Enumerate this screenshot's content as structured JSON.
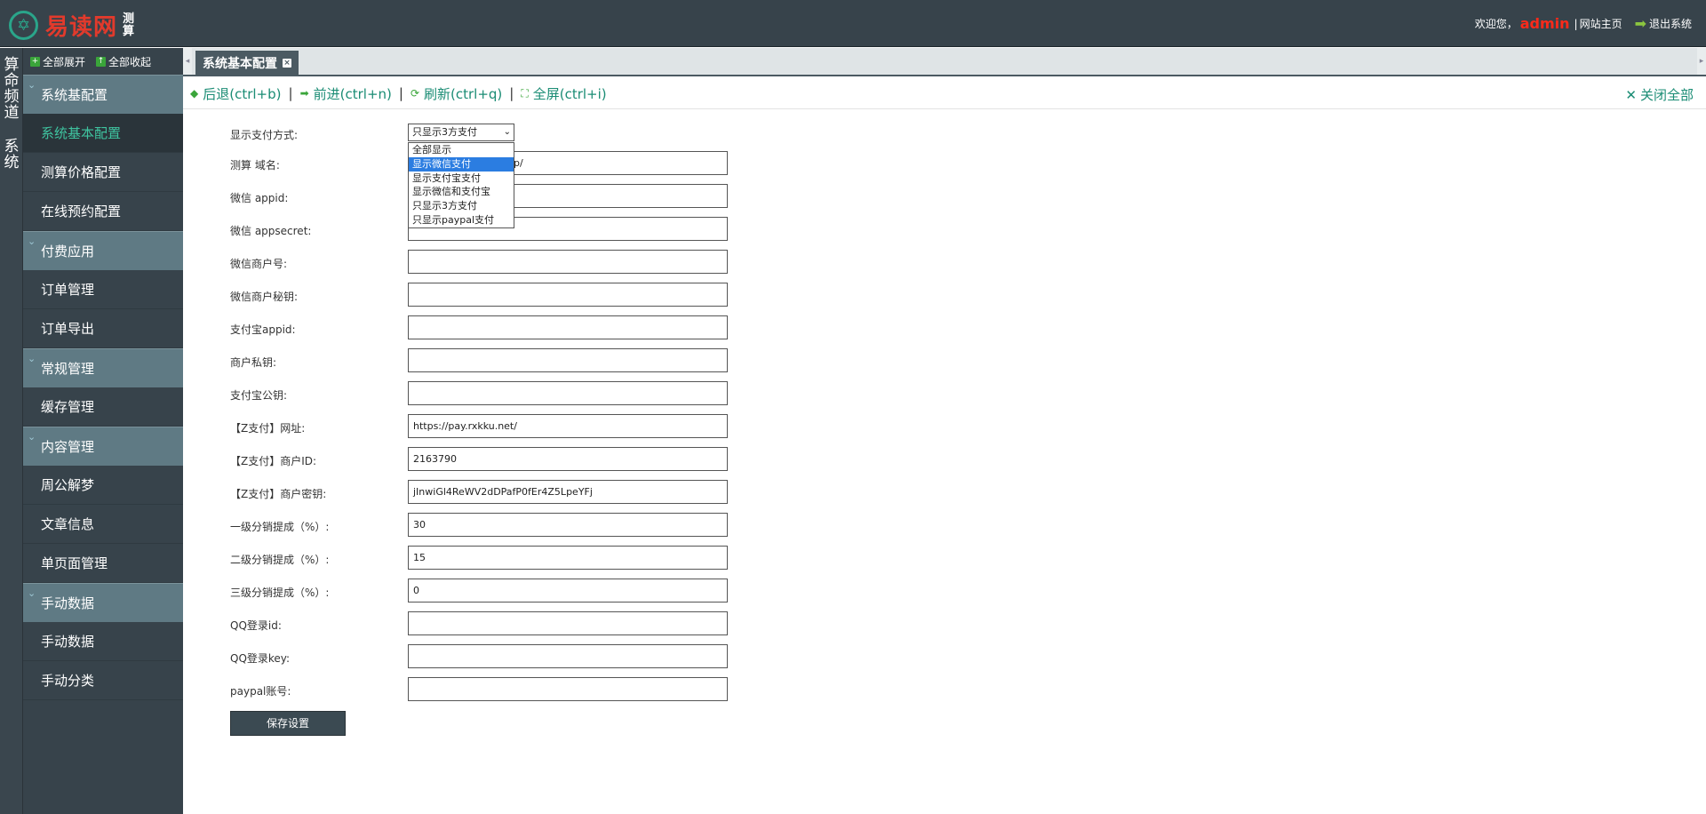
{
  "header": {
    "logo_mark": "✡",
    "logo_text": "易读网",
    "logo_sub": "测算",
    "welcome": "欢迎您，",
    "admin": "admin",
    "sep": "|",
    "home_link": "网站主页",
    "exit_link": "退出系统"
  },
  "vertical_nav": {
    "text1": "算命频道",
    "text2": "系统"
  },
  "sidebar": {
    "expand_all": "全部展开",
    "collapse_all": "全部收起",
    "groups": [
      {
        "label": "系统基配置",
        "items": [
          "系统基本配置",
          "测算价格配置",
          "在线预约配置"
        ]
      },
      {
        "label": "付费应用",
        "items": [
          "订单管理",
          "订单导出"
        ]
      },
      {
        "label": "常规管理",
        "items": [
          "缓存管理"
        ]
      },
      {
        "label": "内容管理",
        "items": [
          "周公解梦",
          "文章信息",
          "单页面管理"
        ]
      },
      {
        "label": "手动数据",
        "items": [
          "手动数据",
          "手动分类"
        ]
      }
    ],
    "active_item": "系统基本配置"
  },
  "tabs": {
    "active_label": "系统基本配置"
  },
  "navbar": {
    "back": "后退(ctrl+b)",
    "forward": "前进(ctrl+n)",
    "refresh": "刷新(ctrl+q)",
    "fullscreen": "全屏(ctrl+i)",
    "close_all": "关闭全部",
    "sep": "|"
  },
  "form": {
    "pay_mode_label": "显示支付方式:",
    "pay_mode_selected": "只显示3方支付",
    "pay_mode_options": [
      "全部显示",
      "显示微信支付",
      "显示支付宝支付",
      "显示微信和支付宝",
      "只显示3方支付",
      "只显示paypal支付"
    ],
    "pay_mode_highlighted": "显示微信支付",
    "fields": [
      {
        "label": "测算 域名:",
        "value": "p/"
      },
      {
        "label": "微信 appid:",
        "value": ""
      },
      {
        "label": "微信 appsecret:",
        "value": ""
      },
      {
        "label": "微信商户号:",
        "value": ""
      },
      {
        "label": "微信商户秘钥:",
        "value": ""
      },
      {
        "label": "支付宝appid:",
        "value": ""
      },
      {
        "label": "商户私钥:",
        "value": ""
      },
      {
        "label": "支付宝公钥:",
        "value": ""
      },
      {
        "label": "【Z支付】网址:",
        "value": "https://pay.rxkku.net/"
      },
      {
        "label": "【Z支付】商户ID:",
        "value": "2163790"
      },
      {
        "label": "【Z支付】商户密钥:",
        "value": "jInwiGl4ReWV2dDPafP0fEr4Z5LpeYFj"
      },
      {
        "label": "一级分销提成（%）:",
        "value": "30"
      },
      {
        "label": "二级分销提成（%）:",
        "value": "15"
      },
      {
        "label": "三级分销提成（%）:",
        "value": "0"
      },
      {
        "label": "QQ登录id:",
        "value": ""
      },
      {
        "label": "QQ登录key:",
        "value": ""
      },
      {
        "label": "paypal账号:",
        "value": ""
      }
    ],
    "save_label": "保存设置"
  }
}
